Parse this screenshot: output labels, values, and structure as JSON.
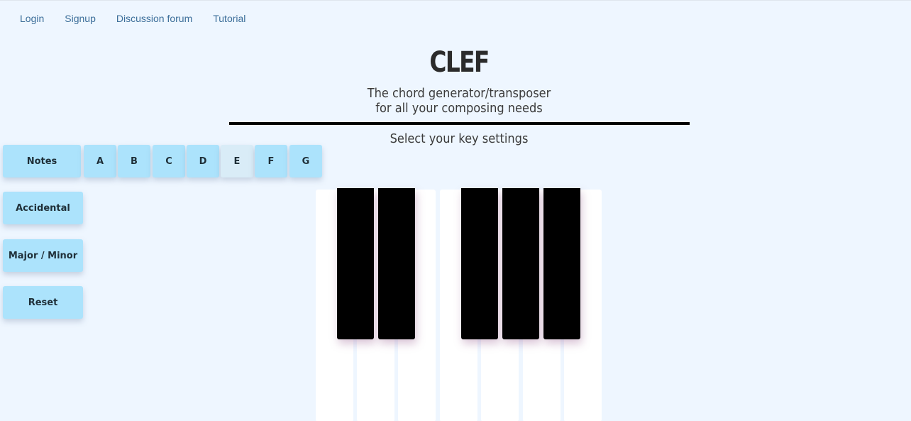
{
  "nav": {
    "login": "Login",
    "signup": "Signup",
    "forum": "Discussion forum",
    "tutorial": "Tutorial"
  },
  "header": {
    "title": "CLEF",
    "tagline_line1": "The chord generator/transposer",
    "tagline_line2": "for all your composing needs",
    "select_label": "Select your key settings"
  },
  "controls": {
    "notes_label": "Notes",
    "note_buttons": [
      "A",
      "B",
      "C",
      "D",
      "E",
      "F",
      "G"
    ],
    "active_note": "E",
    "accidental_label": "Accidental",
    "major_minor_label": "Major / Minor",
    "reset_label": "Reset"
  },
  "piano": {
    "white_keys": 7,
    "black_keys": 5
  },
  "colors": {
    "background": "#eef6ff",
    "button": "#ace3fc",
    "button_active": "#d9ecf7",
    "nav_link": "#3c6e9a"
  }
}
